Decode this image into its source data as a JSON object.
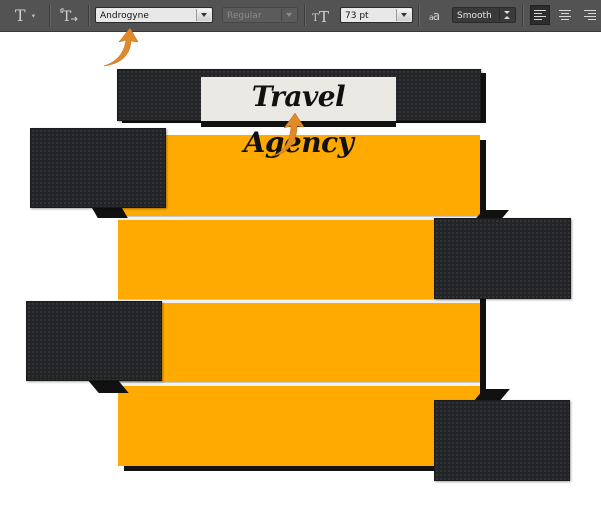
{
  "toolbar": {
    "tool_icon": "type-tool-icon",
    "orient_icon": "text-orientation-icon",
    "font_family": "Androgyne",
    "font_style": "Regular",
    "size_icon": "font-size-icon",
    "font_size": "73 pt",
    "aa_icon": "anti-alias-icon",
    "aa_glyph": "a",
    "anti_alias": "Smooth",
    "align": [
      "left",
      "center",
      "right"
    ],
    "active_align": "left"
  },
  "canvas": {
    "title": "Travel Agency",
    "accent_color": "#ffaa00",
    "dark_color": "#232427",
    "arrow_color": "#e08a2a"
  }
}
